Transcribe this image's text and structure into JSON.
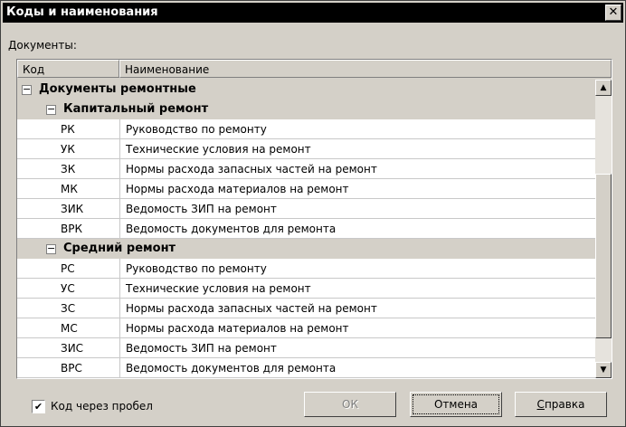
{
  "window": {
    "title": "Коды и наименования",
    "close_glyph": "✕"
  },
  "section_label": "Документы:",
  "table": {
    "headers": [
      "Код",
      "Наименование"
    ],
    "rows": [
      {
        "type": "group",
        "level": 0,
        "expander": "−",
        "text": "Документы ремонтные"
      },
      {
        "type": "group",
        "level": 1,
        "expander": "−",
        "text": "Капитальный ремонт"
      },
      {
        "type": "item",
        "code": "РК",
        "name": "Руководство по ремонту"
      },
      {
        "type": "item",
        "code": "УК",
        "name": "Технические условия на ремонт"
      },
      {
        "type": "item",
        "code": "ЗК",
        "name": "Нормы расхода запасных частей на ремонт"
      },
      {
        "type": "item",
        "code": "МК",
        "name": "Нормы расхода материалов на ремонт"
      },
      {
        "type": "item",
        "code": "ЗИК",
        "name": "Ведомость ЗИП на ремонт"
      },
      {
        "type": "item",
        "code": "ВРК",
        "name": "Ведомость документов для ремонта"
      },
      {
        "type": "group",
        "level": 1,
        "expander": "−",
        "text": "Средний ремонт"
      },
      {
        "type": "item",
        "code": "РС",
        "name": "Руководство по ремонту"
      },
      {
        "type": "item",
        "code": "УС",
        "name": "Технические условия на ремонт"
      },
      {
        "type": "item",
        "code": "ЗС",
        "name": "Нормы расхода запасных частей на ремонт"
      },
      {
        "type": "item",
        "code": "МС",
        "name": "Нормы расхода материалов на ремонт"
      },
      {
        "type": "item",
        "code": "ЗИС",
        "name": "Ведомость ЗИП на ремонт"
      },
      {
        "type": "item",
        "code": "ВРС",
        "name": "Ведомость документов для ремонта"
      }
    ]
  },
  "scrollbar": {
    "up_glyph": "▲",
    "down_glyph": "▼"
  },
  "checkbox": {
    "checked": true,
    "mark": "✔",
    "label": "Код через пробел"
  },
  "buttons": {
    "ok": "ОК",
    "cancel": "Отмена",
    "help_prefix": "С",
    "help_rest": "правка"
  }
}
